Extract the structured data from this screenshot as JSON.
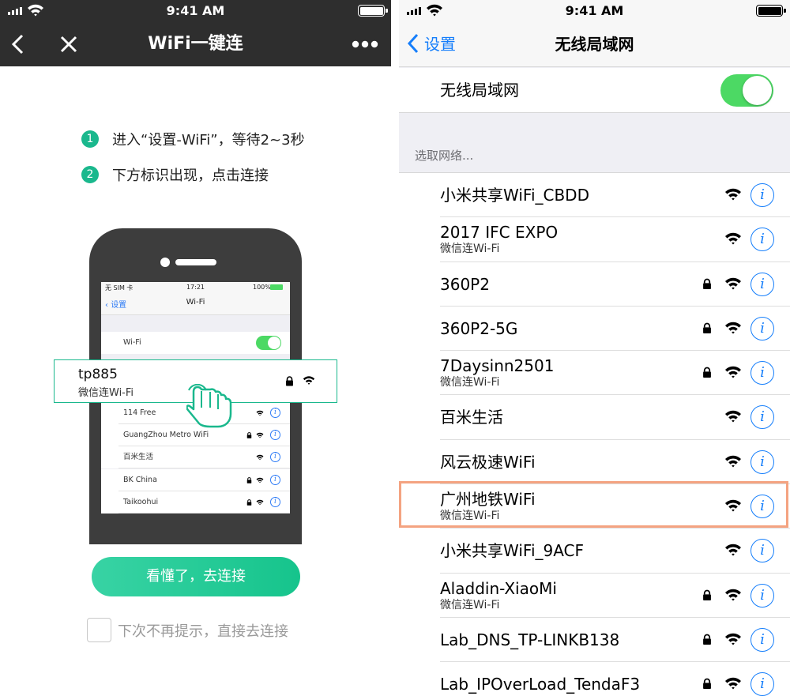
{
  "left": {
    "status": {
      "time": "9:41 AM"
    },
    "nav": {
      "title": "WiFi一键连",
      "back_icon": "chevron-left-icon",
      "close_icon": "close-icon",
      "more_icon": "more-dots-icon"
    },
    "steps": [
      {
        "num": "1",
        "text": "进入“设置-WiFi”，等待2~3秒"
      },
      {
        "num": "2",
        "text": "下方标识出现，点击连接"
      }
    ],
    "illustration": {
      "status_carrier": "无 SIM 卡",
      "status_time": "17:21",
      "status_battery": "100%",
      "back_label": "设置",
      "title": "Wi-Fi",
      "wifi_label": "Wi-Fi",
      "highlight_network": {
        "name": "tp885",
        "subtitle": "微信连Wi-Fi"
      },
      "networks": [
        {
          "name": "114 Free",
          "locked": false
        },
        {
          "name": "GuangZhou Metro WiFi",
          "locked": true
        },
        {
          "name": "百米生活",
          "locked": false
        },
        {
          "name": "BK China",
          "locked": true
        },
        {
          "name": "Taikoohui",
          "locked": true
        }
      ]
    },
    "cta_label": "看懂了，去连接",
    "checkbox_label": "下次不再提示，直接去连接"
  },
  "right": {
    "status": {
      "time": "9:41 AM"
    },
    "nav": {
      "back_label": "设置",
      "title": "无线局域网"
    },
    "wifi_toggle": {
      "label": "无线局域网",
      "on": true
    },
    "section_header": "选取网络...",
    "networks": [
      {
        "name": " 小米共享WiFi_CBDD",
        "subtitle": "",
        "locked": false
      },
      {
        "name": "2017 IFC EXPO",
        "subtitle": "微信连Wi-Fi",
        "locked": false
      },
      {
        "name": "360P2",
        "subtitle": "",
        "locked": true
      },
      {
        "name": "360P2-5G",
        "subtitle": "",
        "locked": true
      },
      {
        "name": "7Daysinn2501",
        "subtitle": "微信连Wi-Fi",
        "locked": true
      },
      {
        "name": "百米生活",
        "subtitle": "",
        "locked": false
      },
      {
        "name": "风云极速WiFi",
        "subtitle": "",
        "locked": false
      },
      {
        "name": "广州地铁WiFi",
        "subtitle": "微信连Wi-Fi",
        "locked": false,
        "highlighted": true
      },
      {
        "name": "小米共享WiFi_9ACF",
        "subtitle": "",
        "locked": false
      },
      {
        "name": "Aladdin-XiaoMi",
        "subtitle": "微信连Wi-Fi",
        "locked": true
      },
      {
        "name": "Lab_DNS_TP-LINKB138",
        "subtitle": "",
        "locked": true
      },
      {
        "name": "Lab_IPOverLoad_TendaF3",
        "subtitle": "",
        "locked": true
      }
    ],
    "colors": {
      "accent": "#157efb",
      "switch_on": "#4cd964",
      "highlight": "#f4a381"
    }
  },
  "colors": {
    "brand": "#1ab88d",
    "nav_dark": "#2e2e2e"
  }
}
